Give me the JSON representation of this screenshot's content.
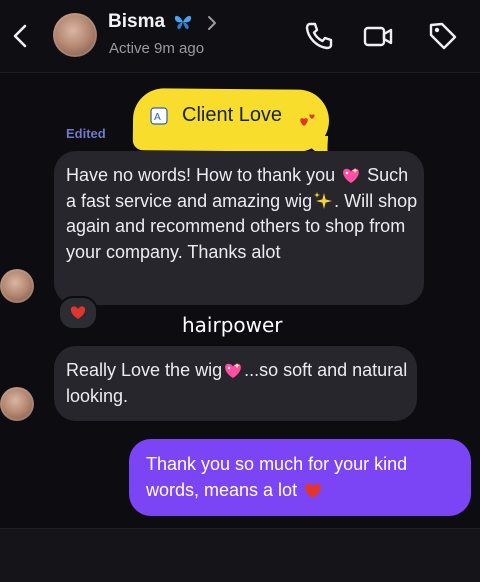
{
  "header": {
    "contact_name": "Bisma",
    "status": "Active 9m ago"
  },
  "sticker": {
    "label": "Client Love"
  },
  "edited_label": "Edited",
  "messages": [
    {
      "segments": [
        "Have no words! How to thank you ",
        " Such a fast service and amazing wig",
        ". Will shop again and recommend others to shop from your company. Thanks alot"
      ],
      "emojis": [
        "sparkling-heart-icon",
        "sparkles-icon"
      ],
      "reaction": "red-heart-icon"
    },
    {
      "segments": [
        "Really Love the wig",
        "...so soft and natural looking."
      ],
      "emojis": [
        "sparkling-heart-icon"
      ]
    },
    {
      "segments": [
        "Thank you so much for your kind words, means a lot "
      ],
      "emojis": [
        "red-heart-icon"
      ]
    }
  ],
  "watermark": "hairpower",
  "colors": {
    "background": "#0c0c11",
    "incoming_bubble": "#26262c",
    "outgoing_bubble": "#7b45f5",
    "sticker": "#f8dd2c",
    "edited": "#6f79c5"
  }
}
